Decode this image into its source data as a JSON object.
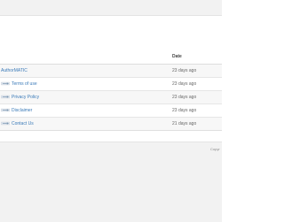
{
  "table": {
    "date_header": "Date",
    "rows": [
      {
        "title": "AuthorMATIC",
        "date": "23 days ago",
        "is_child": false
      },
      {
        "title": "Terms of use",
        "date": "23 days ago",
        "is_child": true
      },
      {
        "title": "Privacy Policy",
        "date": "23 days ago",
        "is_child": true
      },
      {
        "title": "Disclaimer",
        "date": "23 days ago",
        "is_child": true
      },
      {
        "title": "Contact Us",
        "date": "21 days ago",
        "is_child": true
      }
    ]
  },
  "footer": {
    "copyright": "Copyr"
  },
  "colors": {
    "link": "#3a7ab8",
    "bar_background": "#f2f2f2"
  },
  "icons": {
    "child_page": "child-arrow-icon"
  }
}
